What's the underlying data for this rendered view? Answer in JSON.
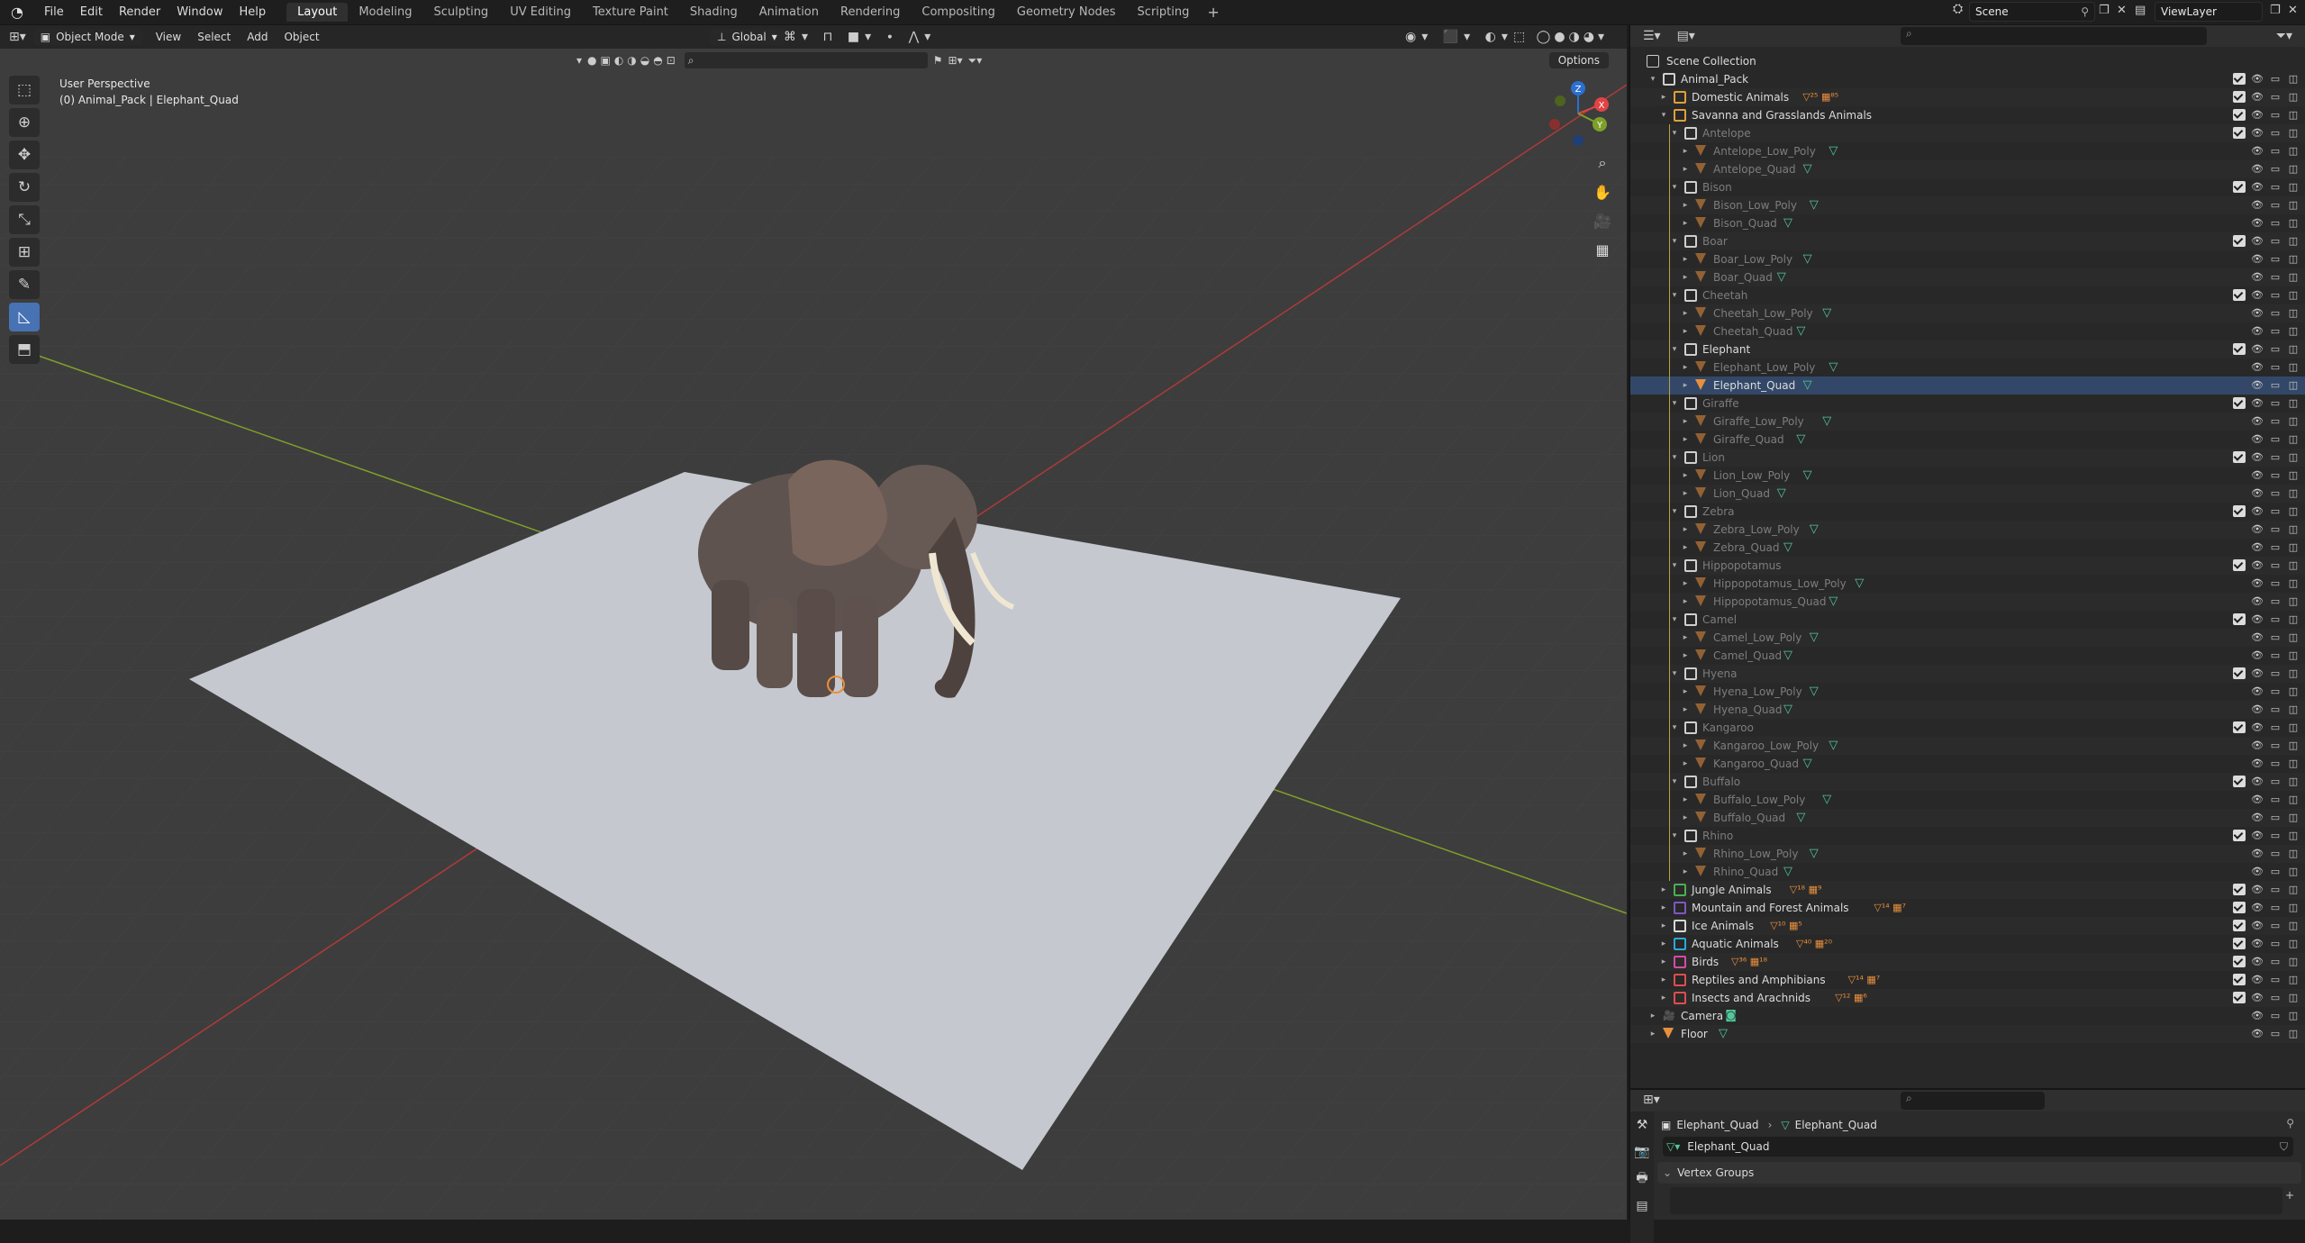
{
  "menu": [
    "File",
    "Edit",
    "Render",
    "Window",
    "Help"
  ],
  "workspaces": [
    "Layout",
    "Modeling",
    "Sculpting",
    "UV Editing",
    "Texture Paint",
    "Shading",
    "Animation",
    "Rendering",
    "Compositing",
    "Geometry Nodes",
    "Scripting"
  ],
  "active_workspace": "Layout",
  "scene": "Scene",
  "view_layer": "ViewLayer",
  "viewport_header": {
    "mode": "Object Mode",
    "menus": [
      "View",
      "Select",
      "Add",
      "Object"
    ],
    "orientation": "Global",
    "options": "Options"
  },
  "viewport_info": {
    "line1": "User Perspective",
    "line2": "(0) Animal_Pack | Elephant_Quad"
  },
  "gizmo": {
    "x": "X",
    "y": "Y",
    "z": "Z"
  },
  "outliner": {
    "root": "Scene Collection",
    "rows": [
      {
        "label": "Animal_Pack",
        "level": 1,
        "type": "collection",
        "open": true,
        "check": true
      },
      {
        "label": "Domestic Animals",
        "level": 2,
        "type": "collection",
        "open": false,
        "check": true,
        "extra": "▽²⁵ ▦⁸⁵"
      },
      {
        "label": "Savanna and Grasslands Animals",
        "level": 2,
        "type": "collection",
        "open": true,
        "check": true
      },
      {
        "label": "Antelope",
        "level": 3,
        "type": "collection",
        "open": true,
        "check": true,
        "dim": true
      },
      {
        "label": "Antelope_Low_Poly",
        "level": 4,
        "type": "object",
        "dim": true
      },
      {
        "label": "Antelope_Quad",
        "level": 4,
        "type": "object",
        "dim": true
      },
      {
        "label": "Bison",
        "level": 3,
        "type": "collection",
        "open": true,
        "check": true,
        "dim": true
      },
      {
        "label": "Bison_Low_Poly",
        "level": 4,
        "type": "object",
        "dim": true
      },
      {
        "label": "Bison_Quad",
        "level": 4,
        "type": "object",
        "dim": true
      },
      {
        "label": "Boar",
        "level": 3,
        "type": "collection",
        "open": true,
        "check": true,
        "dim": true
      },
      {
        "label": "Boar_Low_Poly",
        "level": 4,
        "type": "object",
        "dim": true
      },
      {
        "label": "Boar_Quad",
        "level": 4,
        "type": "object",
        "dim": true
      },
      {
        "label": "Cheetah",
        "level": 3,
        "type": "collection",
        "open": true,
        "check": true,
        "dim": true
      },
      {
        "label": "Cheetah_Low_Poly",
        "level": 4,
        "type": "object",
        "dim": true
      },
      {
        "label": "Cheetah_Quad",
        "level": 4,
        "type": "object",
        "dim": true
      },
      {
        "label": "Elephant",
        "level": 3,
        "type": "collection",
        "open": true,
        "check": true
      },
      {
        "label": "Elephant_Low_Poly",
        "level": 4,
        "type": "object",
        "dim": true
      },
      {
        "label": "Elephant_Quad",
        "level": 4,
        "type": "object",
        "selected": true
      },
      {
        "label": "Giraffe",
        "level": 3,
        "type": "collection",
        "open": true,
        "check": true,
        "dim": true
      },
      {
        "label": "Giraffe_Low_Poly",
        "level": 4,
        "type": "object",
        "dim": true
      },
      {
        "label": "Giraffe_Quad",
        "level": 4,
        "type": "object",
        "dim": true
      },
      {
        "label": "Lion",
        "level": 3,
        "type": "collection",
        "open": true,
        "check": true,
        "dim": true
      },
      {
        "label": "Lion_Low_Poly",
        "level": 4,
        "type": "object",
        "dim": true
      },
      {
        "label": "Lion_Quad",
        "level": 4,
        "type": "object",
        "dim": true
      },
      {
        "label": "Zebra",
        "level": 3,
        "type": "collection",
        "open": true,
        "check": true,
        "dim": true
      },
      {
        "label": "Zebra_Low_Poly",
        "level": 4,
        "type": "object",
        "dim": true
      },
      {
        "label": "Zebra_Quad",
        "level": 4,
        "type": "object",
        "dim": true
      },
      {
        "label": "Hippopotamus",
        "level": 3,
        "type": "collection",
        "open": true,
        "check": true,
        "dim": true
      },
      {
        "label": "Hippopotamus_Low_Poly",
        "level": 4,
        "type": "object",
        "dim": true
      },
      {
        "label": "Hippopotamus_Quad",
        "level": 4,
        "type": "object",
        "dim": true
      },
      {
        "label": "Camel",
        "level": 3,
        "type": "collection",
        "open": true,
        "check": true,
        "dim": true
      },
      {
        "label": "Camel_Low_Poly",
        "level": 4,
        "type": "object",
        "dim": true
      },
      {
        "label": "Camel_Quad",
        "level": 4,
        "type": "object",
        "dim": true
      },
      {
        "label": "Hyena",
        "level": 3,
        "type": "collection",
        "open": true,
        "check": true,
        "dim": true
      },
      {
        "label": "Hyena_Low_Poly",
        "level": 4,
        "type": "object",
        "dim": true
      },
      {
        "label": "Hyena_Quad",
        "level": 4,
        "type": "object",
        "dim": true
      },
      {
        "label": "Kangaroo",
        "level": 3,
        "type": "collection",
        "open": true,
        "check": true,
        "dim": true
      },
      {
        "label": "Kangaroo_Low_Poly",
        "level": 4,
        "type": "object",
        "dim": true
      },
      {
        "label": "Kangaroo_Quad",
        "level": 4,
        "type": "object",
        "dim": true
      },
      {
        "label": "Buffalo",
        "level": 3,
        "type": "collection",
        "open": true,
        "check": true,
        "dim": true
      },
      {
        "label": "Buffalo_Low_Poly",
        "level": 4,
        "type": "object",
        "dim": true
      },
      {
        "label": "Buffalo_Quad",
        "level": 4,
        "type": "object",
        "dim": true
      },
      {
        "label": "Rhino",
        "level": 3,
        "type": "collection",
        "open": true,
        "check": true,
        "dim": true
      },
      {
        "label": "Rhino_Low_Poly",
        "level": 4,
        "type": "object",
        "dim": true
      },
      {
        "label": "Rhino_Quad",
        "level": 4,
        "type": "object",
        "dim": true
      },
      {
        "label": "Jungle Animals",
        "level": 2,
        "type": "collection",
        "open": false,
        "check": true,
        "color": "#4caf50",
        "extra": "▽¹⁸ ▦⁹"
      },
      {
        "label": "Mountain and Forest Animals",
        "level": 2,
        "type": "collection",
        "open": false,
        "check": true,
        "color": "#7e57c2",
        "extra": "▽¹⁴ ▦⁷"
      },
      {
        "label": "Ice Animals",
        "level": 2,
        "type": "collection",
        "open": false,
        "check": true,
        "color": "#d8d8d8",
        "extra": "▽¹⁰ ▦⁵"
      },
      {
        "label": "Aquatic Animals",
        "level": 2,
        "type": "collection",
        "open": false,
        "check": true,
        "color": "#29a9d9",
        "extra": "▽⁴⁰ ▦²⁰"
      },
      {
        "label": "Birds",
        "level": 2,
        "type": "collection",
        "open": false,
        "check": true,
        "color": "#d64ca0",
        "extra": "▽³⁶ ▦¹⁸"
      },
      {
        "label": "Reptiles and Amphibians",
        "level": 2,
        "type": "collection",
        "open": false,
        "check": true,
        "color": "#e04d4d",
        "extra": "▽¹⁴ ▦⁷"
      },
      {
        "label": "Insects and Arachnids",
        "level": 2,
        "type": "collection",
        "open": false,
        "check": true,
        "color": "#e04d4d",
        "extra": "▽¹² ▦⁶"
      },
      {
        "label": "Camera",
        "level": 1,
        "type": "camera",
        "open": false
      },
      {
        "label": "Floor",
        "level": 1,
        "type": "object",
        "open": false
      }
    ]
  },
  "properties": {
    "breadcrumb_object": "Elephant_Quad",
    "breadcrumb_data": "Elephant_Quad",
    "data_name": "Elephant_Quad",
    "panel": "Vertex Groups"
  },
  "colors": {
    "accent": "#4772b3",
    "grid_red": "#b03a3a",
    "grid_green": "#7ea02a",
    "plane": "#c5c8cf",
    "orange": "#e98f3c",
    "mesh_green": "#52c89a"
  }
}
